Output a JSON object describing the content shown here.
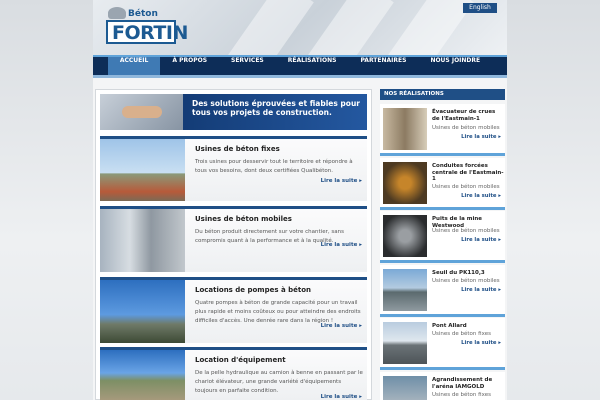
{
  "header": {
    "logo_top": "Béton",
    "logo_main": "FORTIN",
    "lang_link": "English"
  },
  "nav": {
    "items": [
      "ACCUEIL",
      "À PROPOS",
      "SERVICES",
      "RÉALISATIONS",
      "PARTENAIRES",
      "NOUS JOINDRE"
    ],
    "active": "ACCUEIL"
  },
  "banner": {
    "text": "Des solutions éprouvées et fiables pour tous vos projets de construction."
  },
  "services": [
    {
      "title": "Usines de béton fixes",
      "desc": "Trois usines pour desservir tout le territoire et répondre à tous vos besoins, dont deux certifiées Qualibéton.",
      "more": "Lire la suite"
    },
    {
      "title": "Usines de béton mobiles",
      "desc": "Du béton produit directement sur votre chantier, sans compromis quant à la performance et à la qualité.",
      "more": "Lire la suite"
    },
    {
      "title": "Locations de pompes à béton",
      "desc": "Quatre pompes à béton de grande capacité pour un travail plus rapide et moins coûteux ou pour atteindre des endroits difficiles d'accès. Une denrée rare dans la région !",
      "more": "Lire la suite"
    },
    {
      "title": "Location d'équipement",
      "desc": "De la pelle hydraulique au camion à benne en passant par le chariot élévateur, une grande variété d'équipements toujours en parfaite condition.",
      "more": "Lire la suite"
    }
  ],
  "sidebar": {
    "heading": "NOS RÉALISATIONS",
    "items": [
      {
        "title": "Évacuateur de crues de l'Eastmain-1",
        "type": "Usines de béton mobiles",
        "more": "Lire la suite"
      },
      {
        "title": "Conduites forcées centrale de l'Eastmain-1",
        "type": "Usines de béton mobiles",
        "more": "Lire la suite"
      },
      {
        "title": "Puits de la mine Westwood",
        "type": "Usines de béton mobiles",
        "more": "Lire la suite"
      },
      {
        "title": "Seuil du PK110,3",
        "type": "Usines de béton mobiles",
        "more": "Lire la suite"
      },
      {
        "title": "Pont Allard",
        "type": "Usines de béton fixes",
        "more": "Lire la suite"
      },
      {
        "title": "Agrandissement de l'aréna IAMGOLD",
        "type": "Usines de béton fixes",
        "more": "Lire la suite"
      }
    ]
  }
}
